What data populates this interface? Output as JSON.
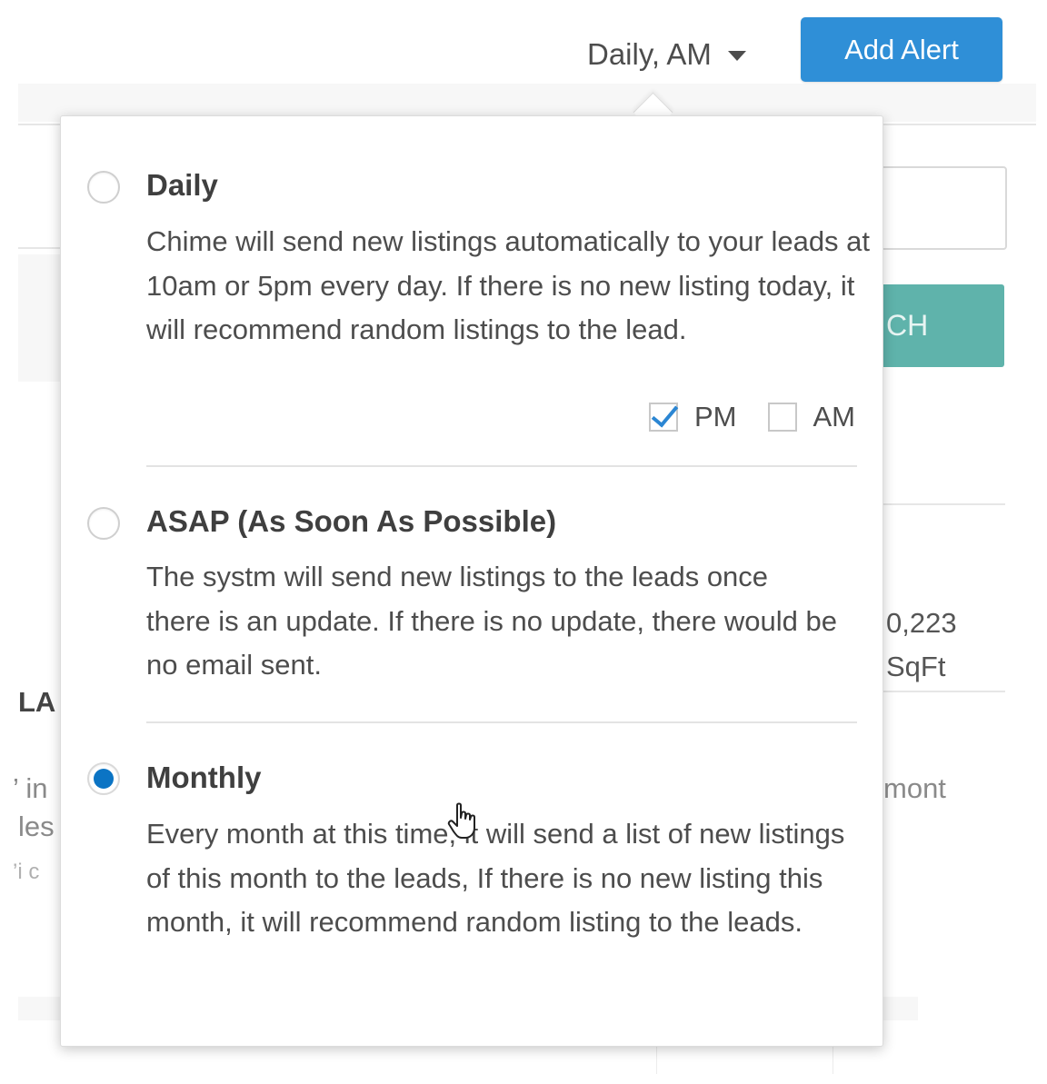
{
  "header": {
    "frequency_selected": "Daily, AM",
    "add_alert_label": "Add Alert"
  },
  "background": {
    "search_button_partial": "CH",
    "sqft_value_partial": "0,223",
    "sqft_unit_partial": "SqFt",
    "left_fragment_1": "LA",
    "left_fragment_2": "’ in",
    "left_fragment_3": "les",
    "left_fragment_4": "’i c",
    "right_fragment_1": "mont"
  },
  "dropdown": {
    "options": [
      {
        "title": "Daily",
        "selected": false,
        "description": "Chime will send new listings automatically to your leads at 10am or 5pm every day. If there is no new listing today, it will recommend random listings to the lead."
      },
      {
        "title": "ASAP (As Soon As Possible)",
        "selected": false,
        "description": "The systm will send new listings to the leads once there is an update. If there is no update, there would be no email sent."
      },
      {
        "title": "Monthly",
        "selected": true,
        "description": "Every month at this time, it will send a list of new listings of this month to the leads, If there is no new listing this month, it will recommend random listing to the leads."
      }
    ],
    "daily_times": [
      {
        "label": "PM",
        "checked": true
      },
      {
        "label": "AM",
        "checked": false
      }
    ]
  },
  "colors": {
    "primary_button": "#2f8fd7",
    "search_button": "#5fb3ab",
    "radio_selected": "#0b74c4",
    "checkmark": "#2b86d3"
  },
  "icons": [
    "caret-down-icon",
    "checkmark-icon",
    "hand-pointer-cursor-icon"
  ]
}
